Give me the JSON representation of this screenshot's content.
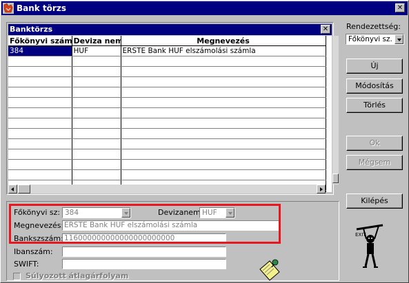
{
  "window": {
    "title": "Bank törzs",
    "close": "✕"
  },
  "grid": {
    "title": "Banktörzs",
    "close": "✕",
    "columns": [
      "Főkönyvi szám",
      "Deviza nem",
      "Megnevezés"
    ],
    "rows": [
      [
        "384",
        "HUF",
        "ERSTE Bank HUF elszámolási számla"
      ]
    ]
  },
  "sort": {
    "label": "Rendezettség:",
    "value": "Főkönyvi sz."
  },
  "buttons": {
    "new": "Új",
    "modify": "Módosítás",
    "delete": "Törlés",
    "ok": "Ok",
    "cancel": "Mégsem",
    "exit": "Kilépés"
  },
  "form": {
    "ledger_label": "Főkönyvi sz:",
    "ledger_value": "384",
    "currency_label": "Devizanem:",
    "currency_value": "HUF",
    "name_label": "Megnevezés:",
    "name_value": "ERSTE Bank HUF elszámolási számla",
    "account_label": "Bankszszám:",
    "account_value": "116000000000000000000000",
    "iban_label": "Ibanszám:",
    "iban_value": "",
    "swift_label": "SWIFT:",
    "swift_value": "",
    "weighted_label": "Súlyozott átlagárfolyam"
  },
  "colors": {
    "title_bar": "#000080",
    "face": "#c0c0c0",
    "highlight_box": "#e8161e"
  }
}
